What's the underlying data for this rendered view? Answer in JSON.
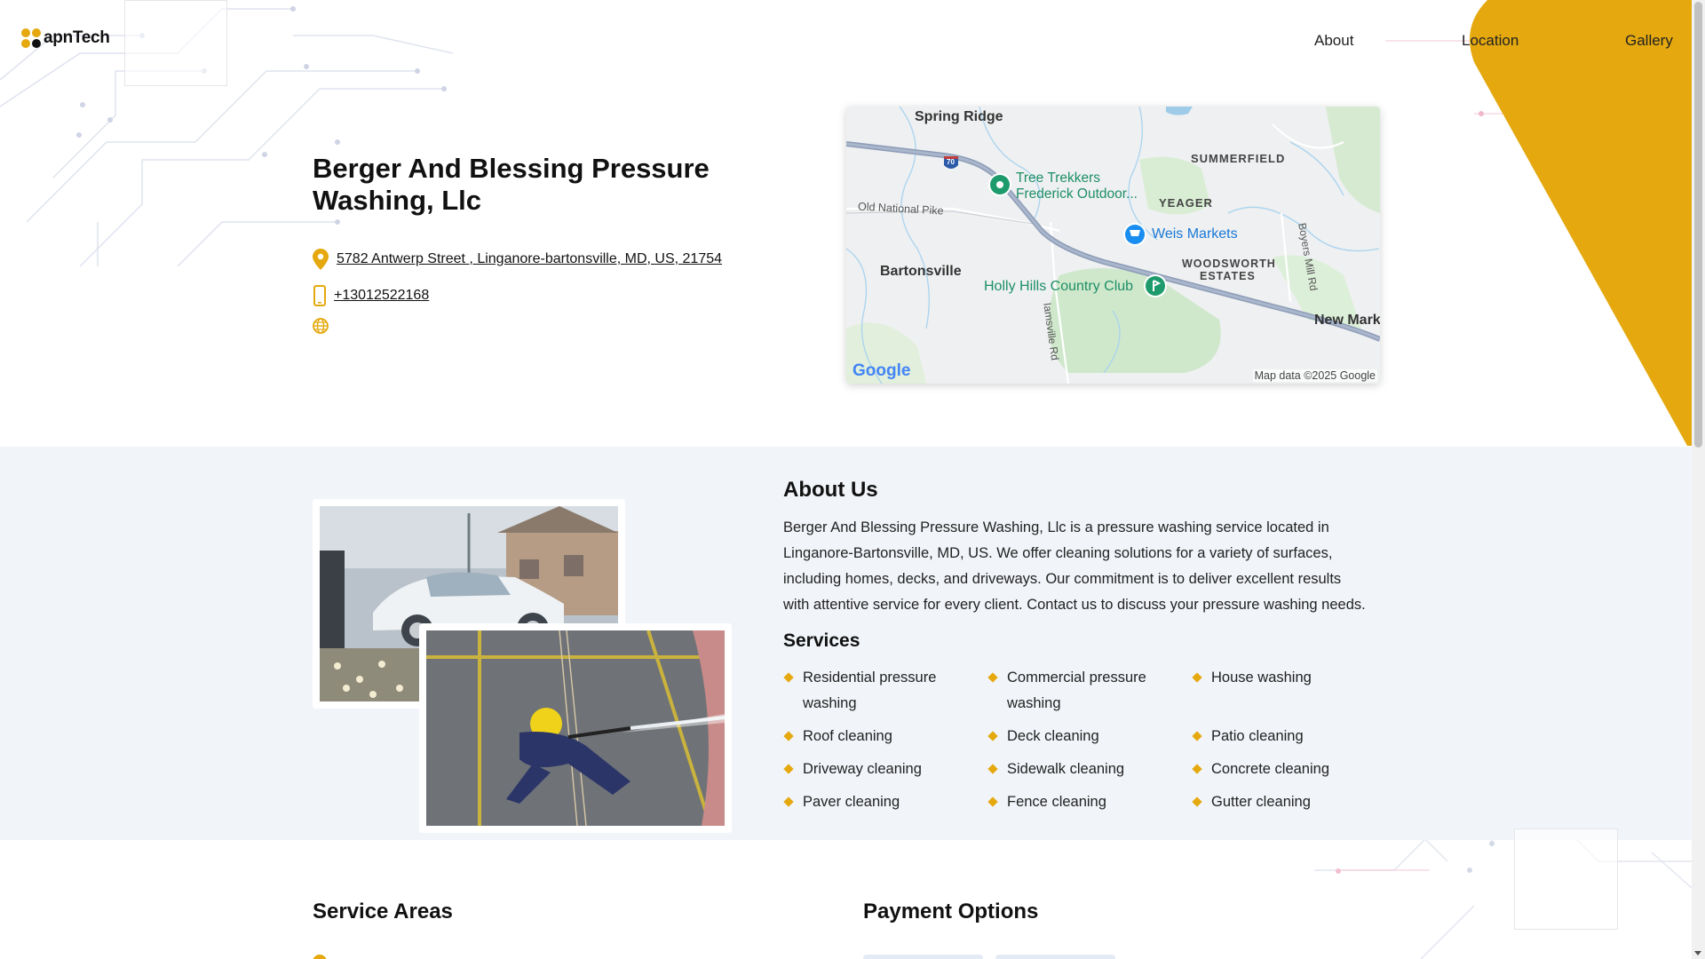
{
  "brand": {
    "logo_text": "apnTech",
    "accent": "#e5a90f"
  },
  "nav": {
    "items": [
      "About",
      "Location",
      "Gallery"
    ]
  },
  "business": {
    "name": "Berger And Blessing Pressure Washing, Llc",
    "address": "5782 Antwerp Street , Linganore-bartonsville, MD, US, 21754",
    "phone": "+13012522168"
  },
  "map": {
    "labels": {
      "spring_ridge": "Spring Ridge",
      "summerfield": "SUMMERFIELD",
      "tree_trekkers_1": "Tree Trekkers",
      "tree_trekkers_2": "Frederick Outdoor...",
      "yeager": "YEAGER",
      "old_national_pike": "Old National Pike",
      "weis_markets": "Weis Markets",
      "bartonsville": "Bartonsville",
      "woodsworth_1": "WOODSWORTH",
      "woodsworth_2": "ESTATES",
      "holly_hills": "Holly Hills Country Club",
      "boyers_mill": "Boyers Mill Rd",
      "iamsville": "Iamsville Rd",
      "new_market": "New Mark",
      "interstate": "70",
      "google": "Google",
      "map_data": "Map data ©2025 Google"
    }
  },
  "about": {
    "title": "About Us",
    "text": "Berger And Blessing Pressure Washing, Llc is a pressure washing service located in Linganore-Bartonsville, MD, US. We offer cleaning solutions for a variety of surfaces, including homes, decks, and driveways. Our commitment is to deliver excellent results with attentive service for every client. Contact us to discuss your pressure washing needs."
  },
  "services": {
    "title": "Services",
    "items": [
      "Residential pressure washing",
      "Commercial pressure washing",
      "House washing",
      "Roof cleaning",
      "Deck cleaning",
      "Patio cleaning",
      "Driveway cleaning",
      "Sidewalk cleaning",
      "Concrete cleaning",
      "Paver cleaning",
      "Fence cleaning",
      "Gutter cleaning"
    ]
  },
  "service_areas": {
    "title": "Service Areas"
  },
  "payment": {
    "title": "Payment Options"
  },
  "icons": {
    "address": "map-pin-icon",
    "phone": "phone-icon",
    "website": "globe-icon"
  }
}
